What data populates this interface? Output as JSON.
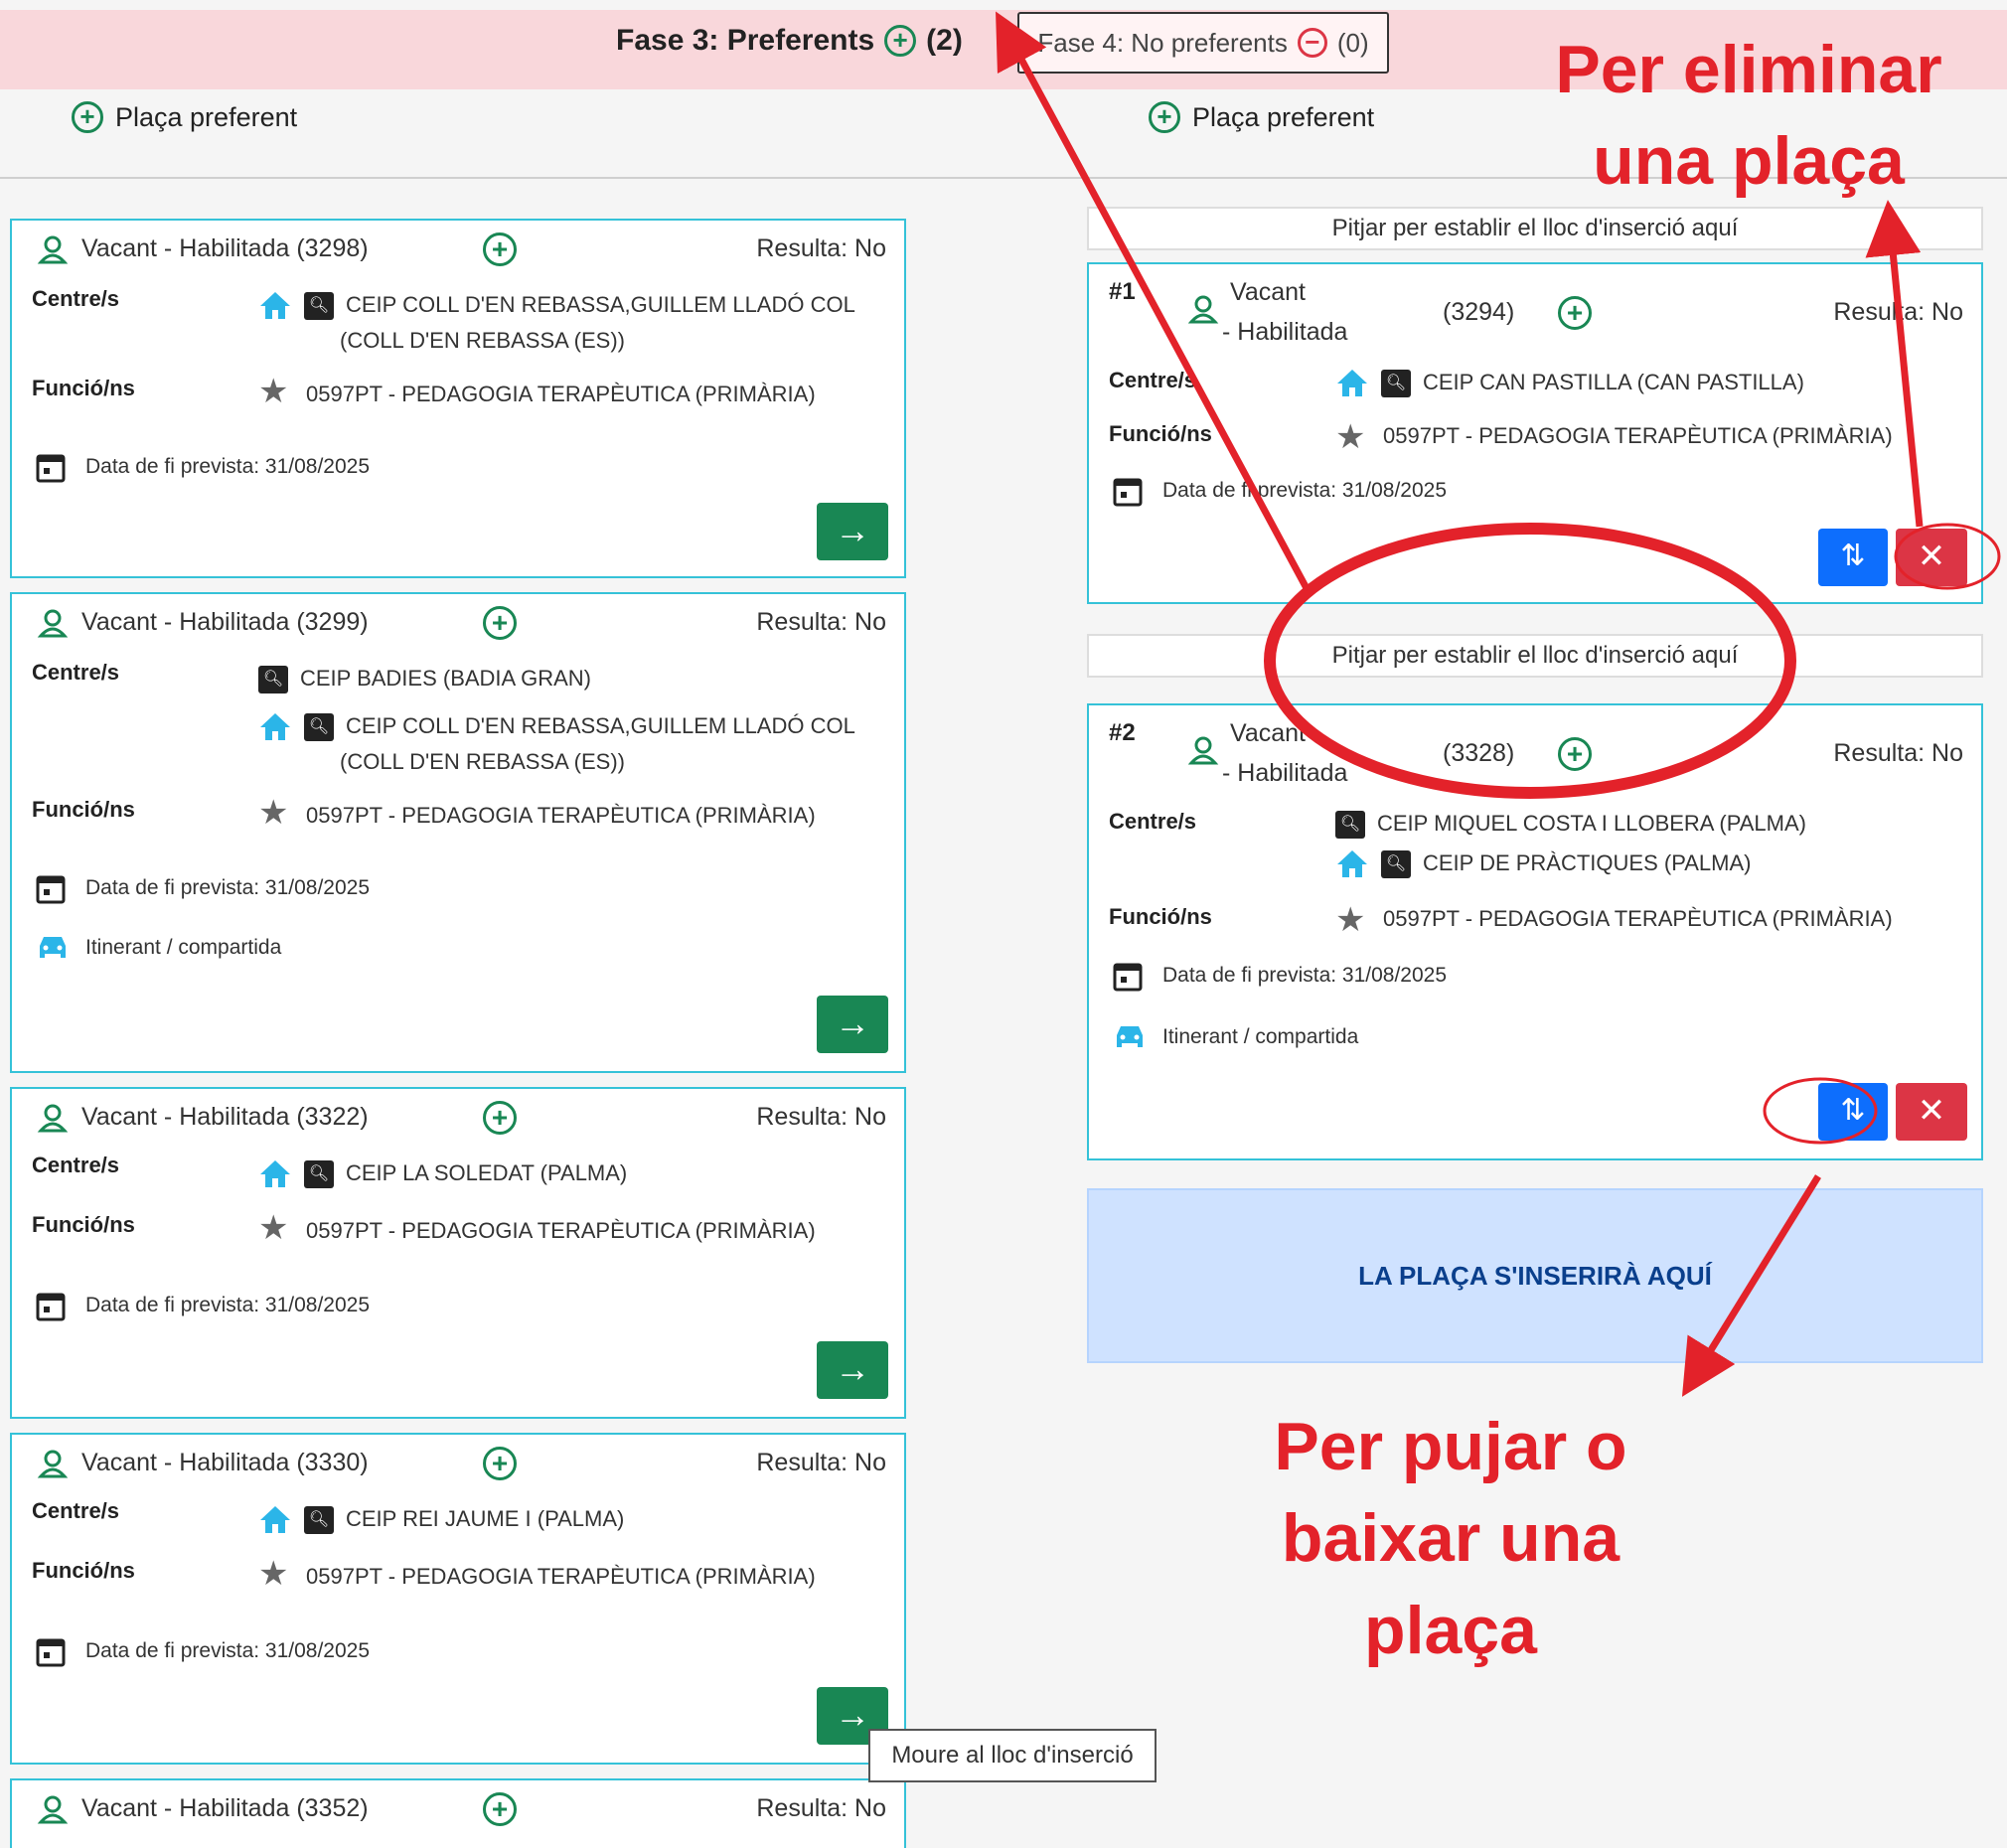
{
  "header": {
    "phase3_label": "Fase 3: Preferents",
    "phase3_count": "(2)",
    "phase4_label": "Fase 4: No preferents",
    "phase4_count": "(0)"
  },
  "add_preferent_label": "Plaça preferent",
  "labels": {
    "centres": "Centre/s",
    "funcions": "Funció/ns",
    "data_fi": "Data de fi prevista: 31/08/2025",
    "itinerant": "Itinerant / compartida",
    "resulta": "Resulta: No"
  },
  "left_cards": [
    {
      "title": "Vacant  - Habilitada (3298)",
      "centre1": "CEIP COLL D'EN REBASSA,GUILLEM LLADÓ COL",
      "centre1b": "(COLL D'EN REBASSA (ES))",
      "funcio": "0597PT - PEDAGOGIA TERAPÈUTICA (PRIMÀRIA)"
    },
    {
      "title": "Vacant  - Habilitada (3299)",
      "centre1": "CEIP BADIES (BADIA GRAN)",
      "centre2": "CEIP COLL D'EN REBASSA,GUILLEM LLADÓ COL",
      "centre2b": "(COLL D'EN REBASSA (ES))",
      "funcio": "0597PT - PEDAGOGIA TERAPÈUTICA (PRIMÀRIA)"
    },
    {
      "title": "Vacant  - Habilitada (3322)",
      "centre1": "CEIP LA SOLEDAT (PALMA)",
      "funcio": "0597PT - PEDAGOGIA TERAPÈUTICA (PRIMÀRIA)"
    },
    {
      "title": "Vacant  - Habilitada (3330)",
      "centre1": "CEIP REI JAUME I (PALMA)",
      "funcio": "0597PT - PEDAGOGIA TERAPÈUTICA (PRIMÀRIA)"
    },
    {
      "title": "Vacant  - Habilitada (3352)"
    }
  ],
  "insert_here": "Pitjar per establir el lloc d'inserció aquí",
  "right_cards": [
    {
      "num": "#1",
      "type": "Vacant",
      "sub": "- Habilitada",
      "code": "(3294)",
      "centre1": "CEIP CAN PASTILLA (CAN PASTILLA)",
      "funcio": "0597PT - PEDAGOGIA TERAPÈUTICA (PRIMÀRIA)"
    },
    {
      "num": "#2",
      "type": "Vacant",
      "sub": "- Habilitada",
      "code": "(3328)",
      "centre1": "CEIP MIQUEL COSTA I LLOBERA (PALMA)",
      "centre2": "CEIP DE PRÀCTIQUES (PALMA)",
      "funcio": "0597PT - PEDAGOGIA TERAPÈUTICA (PRIMÀRIA)"
    }
  ],
  "banner": "LA PLAÇA S'INSERIRÀ AQUÍ",
  "tooltip": "Moure al lloc d'inserció",
  "annotations": {
    "delete_line1": "Per eliminar",
    "delete_line2": "una plaça",
    "move_line1": "Per pujar o",
    "move_line2": "baixar una",
    "move_line3": "plaça"
  },
  "colors": {
    "accent_green": "#198754",
    "accent_blue": "#0d6efd",
    "danger": "#dc3545",
    "annotation_red": "#e3222a",
    "card_border": "#35c2d8",
    "house_blue": "#2bb5e8"
  }
}
